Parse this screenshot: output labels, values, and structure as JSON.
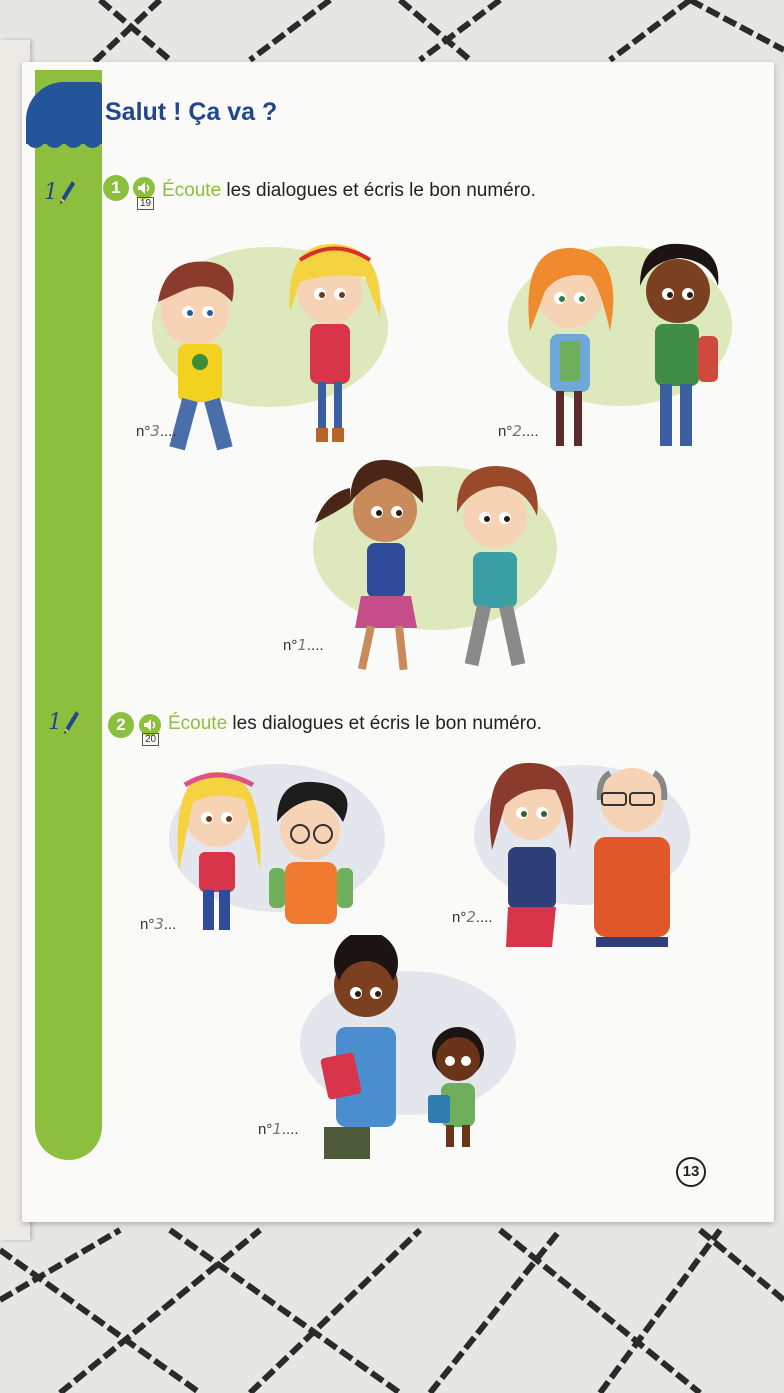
{
  "header": {
    "title": "Salut ! Ça va ?"
  },
  "exercises": [
    {
      "number": "1",
      "pen_marker": "1",
      "track": "19",
      "instruction_keyword": "Écoute",
      "instruction_rest": " les dialogues et écris le bon numéro.",
      "answers": [
        {
          "prefix": "n°",
          "written": "3",
          "dots": "...."
        },
        {
          "prefix": "n°",
          "written": "2",
          "dots": "...."
        },
        {
          "prefix": "n°",
          "written": "1",
          "dots": "...."
        }
      ]
    },
    {
      "number": "2",
      "pen_marker": "1",
      "track": "20",
      "instruction_keyword": "Écoute",
      "instruction_rest": " les dialogues et écris le bon numéro.",
      "answers": [
        {
          "prefix": "n°",
          "written": "3",
          "dots": "..."
        },
        {
          "prefix": "n°",
          "written": "2",
          "dots": "...."
        },
        {
          "prefix": "n°",
          "written": "1",
          "dots": "...."
        }
      ]
    }
  ],
  "footer": {
    "page_number": "13"
  },
  "colors": {
    "green": "#8dbf3f",
    "blue": "#24559a",
    "bubble": "#dde9bc",
    "bubble_grey": "#e4e6ee"
  },
  "icons": [
    "pen-icon",
    "speaker-icon"
  ]
}
